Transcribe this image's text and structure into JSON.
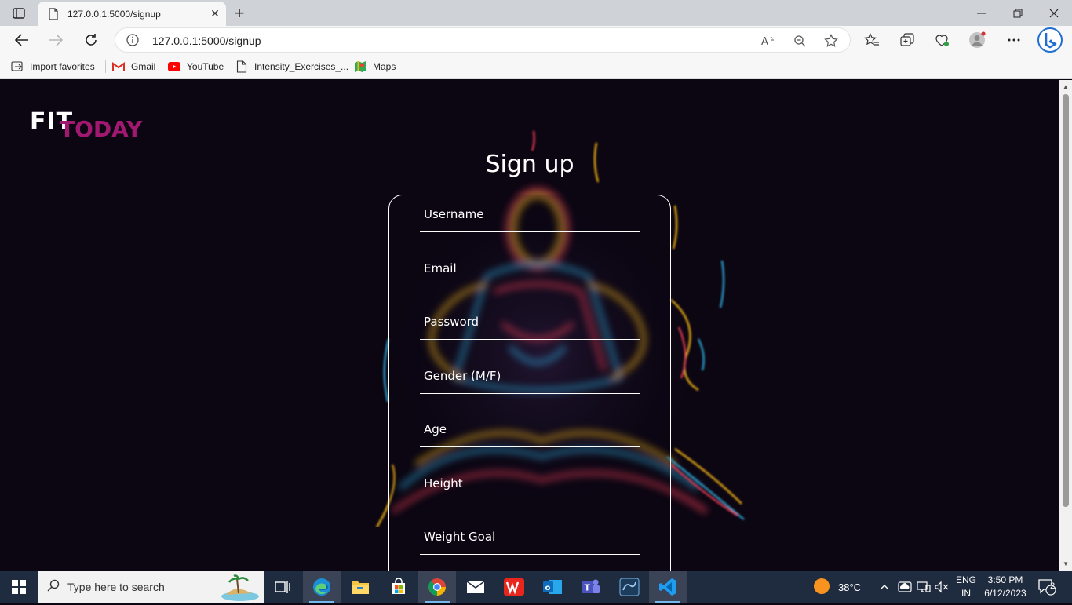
{
  "browser": {
    "tab_title": "127.0.0.1:5000/signup",
    "url": "127.0.0.1:5000/signup",
    "bookmarks": [
      {
        "label": "Import favorites",
        "icon": "import-icon"
      },
      {
        "label": "Gmail",
        "icon": "gmail-icon"
      },
      {
        "label": "YouTube",
        "icon": "youtube-icon"
      },
      {
        "label": "Intensity_Exercises_...",
        "icon": "document-icon"
      },
      {
        "label": "Maps",
        "icon": "maps-icon"
      }
    ]
  },
  "page": {
    "logo_fit": "FIT",
    "logo_today": "TODAY",
    "heading": "Sign up",
    "fields": [
      {
        "label": "Username"
      },
      {
        "label": "Email"
      },
      {
        "label": "Password"
      },
      {
        "label": "Gender (M/F)"
      },
      {
        "label": "Age"
      },
      {
        "label": "Height"
      },
      {
        "label": "Weight Goal"
      }
    ],
    "colors": {
      "logo_accent": "#a0186f",
      "background": "#0c0612"
    }
  },
  "taskbar": {
    "search_placeholder": "Type here to search",
    "weather": "38°C",
    "lang_top": "ENG",
    "lang_bottom": "IN",
    "time": "3:50 PM",
    "date": "6/12/2023",
    "notifications": "2",
    "apps": [
      "task-view-icon",
      "edge-icon",
      "file-explorer-icon",
      "store-icon",
      "chrome-icon",
      "mail-icon",
      "wps-icon",
      "outlook-icon",
      "teams-icon",
      "mysql-workbench-icon",
      "vscode-icon"
    ]
  }
}
